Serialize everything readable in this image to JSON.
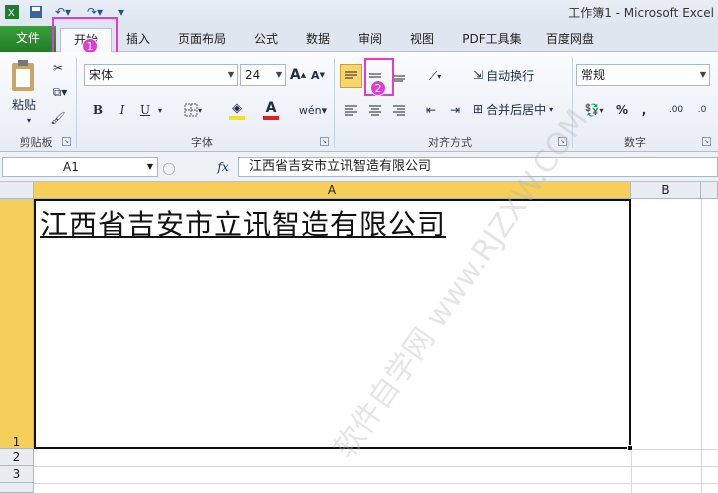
{
  "window": {
    "title": "工作簿1 - Microsoft Excel"
  },
  "quick_access": {
    "icons": [
      "excel-logo-icon",
      "save-icon",
      "undo-icon",
      "redo-icon",
      "customize-icon"
    ]
  },
  "ribbon_tabs": [
    {
      "label": "文件"
    },
    {
      "label": "开始"
    },
    {
      "label": "插入"
    },
    {
      "label": "页面布局"
    },
    {
      "label": "公式"
    },
    {
      "label": "数据"
    },
    {
      "label": "审阅"
    },
    {
      "label": "视图"
    },
    {
      "label": "PDF工具集"
    },
    {
      "label": "百度网盘"
    }
  ],
  "clipboard": {
    "paste_label": "粘贴",
    "group_label": "剪贴板"
  },
  "font": {
    "name": "宋体",
    "size": "24",
    "group_label": "字体",
    "bold": "B",
    "italic": "I",
    "underline": "U",
    "grow": "A",
    "shrink": "A",
    "font_color": "A",
    "phonetic": "wén"
  },
  "alignment": {
    "wrap_text": "自动换行",
    "merge_center": "合并后居中",
    "group_label": "对齐方式"
  },
  "number": {
    "format": "常规",
    "percent": "%",
    "comma": ",",
    "increase_decimal": ".00",
    "decrease_decimal": ".0",
    "group_label": "数字"
  },
  "annotations": [
    {
      "label": "1"
    },
    {
      "label": "2"
    }
  ],
  "formula_bar": {
    "name_box": "A1",
    "fx": "fx",
    "content": "江西省吉安市立讯智造有限公司"
  },
  "sheet": {
    "columns": [
      "A",
      "B"
    ],
    "rows": [
      "1",
      "2",
      "3"
    ],
    "cell_a1": "江西省吉安市立讯智造有限公司"
  },
  "watermark": "软件自学网 www.RJZXW.COM",
  "colors": {
    "file_tab": "#2a8a2e",
    "annotation": "#e23ad8",
    "header_highlight": "#f5cf5a",
    "font_color_underline": "#e0201b",
    "fill_color_underline": "#f7e01d"
  }
}
